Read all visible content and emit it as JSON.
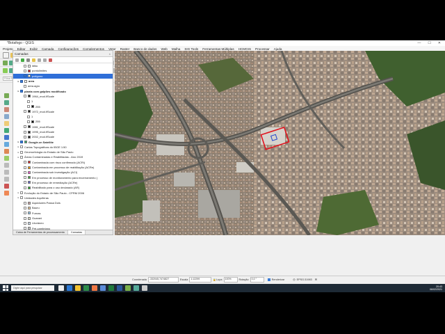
{
  "window": {
    "title": "*Botafogo - QGIS"
  },
  "menu": [
    "Projeto",
    "Editar",
    "Exibir",
    "Camada",
    "Configurações",
    "Complementos",
    "Vetor",
    "Raster",
    "Banco de dados",
    "Web",
    "Malha",
    "SIG Tools",
    "Ferramentas Múltiplas",
    "HCMGIS",
    "Processar",
    "Ajuda"
  ],
  "toolbar": {
    "search_placeholder": "Filtrar Base de Atual...",
    "scale_field": "12",
    "units_field": "mm"
  },
  "layers_panel": {
    "title": "Camadas",
    "close_icon": "×",
    "tabs": [
      "Caixa de Ferramentas de processamento",
      "Camadas"
    ],
    "active_tab": 1,
    "rows": [
      {
        "label": "ldiku",
        "indent": 2,
        "checked": false,
        "swatch": "#ffffff",
        "selected": false,
        "bold": false
      },
      {
        "label": "pontolimites",
        "indent": 2,
        "checked": false,
        "swatch": "#d11",
        "selected": false,
        "bold": false
      },
      {
        "label": "polígono",
        "indent": 2,
        "checked": true,
        "swatch": "#fff",
        "selected": true,
        "bold": false
      },
      {
        "label": "area",
        "indent": 1,
        "checked": true,
        "swatch": "#fff",
        "selected": false,
        "bold": true
      },
      {
        "label": "area.agro",
        "indent": 2,
        "checked": false,
        "swatch": "",
        "selected": false,
        "bold": false
      },
      {
        "label": "planta com galpões modificado",
        "indent": 1,
        "checked": true,
        "swatch": "",
        "selected": false,
        "bold": true
      },
      {
        "label": "1964_mod.ifScale",
        "indent": 2,
        "checked": false,
        "swatch": "#222",
        "selected": false,
        "bold": false
      },
      {
        "label": "1",
        "indent": 3,
        "checked": false,
        "swatch": "",
        "selected": false,
        "bold": false
      },
      {
        "label": "255",
        "indent": 3,
        "checked": false,
        "swatch": "#000",
        "selected": false,
        "bold": false
      },
      {
        "label": "1972_mod.ifScale",
        "indent": 2,
        "checked": false,
        "swatch": "#222",
        "selected": false,
        "bold": false
      },
      {
        "label": "1",
        "indent": 3,
        "checked": false,
        "swatch": "",
        "selected": false,
        "bold": false
      },
      {
        "label": "255",
        "indent": 3,
        "checked": false,
        "swatch": "#000",
        "selected": false,
        "bold": false
      },
      {
        "label": "1981_mod.ifScale",
        "indent": 2,
        "checked": false,
        "swatch": "#222",
        "selected": false,
        "bold": false
      },
      {
        "label": "1995_mod.ifScale",
        "indent": 2,
        "checked": false,
        "swatch": "#222",
        "selected": false,
        "bold": false
      },
      {
        "label": "2002_mod.ifScale",
        "indent": 2,
        "checked": false,
        "swatch": "#222",
        "selected": false,
        "bold": false
      },
      {
        "label": "Google.cn Satellite",
        "indent": 1,
        "checked": true,
        "swatch": "#3a6",
        "selected": false,
        "bold": true
      },
      {
        "label": "Cartas Topográficas do IBGE 1:50",
        "indent": 1,
        "checked": false,
        "swatch": "",
        "selected": false,
        "bold": false
      },
      {
        "label": "Geomorfologia do Estado de São Paulo",
        "indent": 1,
        "checked": false,
        "swatch": "",
        "selected": false,
        "bold": false
      },
      {
        "label": "Áreas Contaminadas e Reabilitadas - Ano 2019",
        "indent": 1,
        "checked": false,
        "swatch": "",
        "selected": false,
        "bold": false
      },
      {
        "label": "Contaminada com risco confirmado (ACRi)",
        "indent": 2,
        "checked": false,
        "swatch": "#d22",
        "selected": false,
        "bold": false
      },
      {
        "label": "Contaminada em processo de reabilitação (ACRe)",
        "indent": 2,
        "checked": false,
        "swatch": "#e90",
        "selected": false,
        "bold": false
      },
      {
        "label": "Contaminada sob investigação (ACI)",
        "indent": 2,
        "checked": false,
        "swatch": "#e5c",
        "selected": false,
        "bold": false
      },
      {
        "label": "Em processo de monitoramento para encerramento (",
        "indent": 2,
        "checked": false,
        "swatch": "#4a4",
        "selected": false,
        "bold": false
      },
      {
        "label": "Em processo de remediação (ACRe)",
        "indent": 2,
        "checked": false,
        "swatch": "#66c",
        "selected": false,
        "bold": false
      },
      {
        "label": "Reabilitado para o uso declarado (AR)",
        "indent": 2,
        "checked": false,
        "swatch": "#2a2",
        "selected": false,
        "bold": false
      },
      {
        "label": "Evolução do Estado de São Paulo - CPRM 2006",
        "indent": 1,
        "checked": false,
        "swatch": "",
        "selected": false,
        "bold": false
      },
      {
        "label": "Unidades Aquíferas",
        "indent": 1,
        "checked": false,
        "swatch": "",
        "selected": false,
        "bold": false
      },
      {
        "label": "Aquicludes Passa Dois",
        "indent": 2,
        "checked": false,
        "swatch": "#caa",
        "selected": false,
        "bold": false
      },
      {
        "label": "Bauru",
        "indent": 2,
        "checked": false,
        "swatch": "#ec9",
        "selected": false,
        "bold": false
      },
      {
        "label": "Furnas",
        "indent": 2,
        "checked": false,
        "swatch": "#9ce",
        "selected": false,
        "bold": false
      },
      {
        "label": "Guarani",
        "indent": 2,
        "checked": false,
        "swatch": "#ddc",
        "selected": false,
        "bold": false
      },
      {
        "label": "Litorâneo",
        "indent": 2,
        "checked": false,
        "swatch": "#cde",
        "selected": false,
        "bold": false
      },
      {
        "label": "Pré-cambriano",
        "indent": 2,
        "checked": false,
        "swatch": "#ccc",
        "selected": false,
        "bold": false
      }
    ]
  },
  "statusbar": {
    "coord_label": "Coordenada",
    "coord_value": "-332045,7474827",
    "scale_label": "Escala",
    "scale_value": "1:12299",
    "magnifier_label": "Lupa",
    "magnifier_value": "100%",
    "rotation_label": "Rotação",
    "rotation_value": "0,0 °",
    "render_label": "Renderizar",
    "crs": "EPSG:31983"
  },
  "taskbar": {
    "search_placeholder": "Digite aqui para pesquisar",
    "time": "20:43",
    "date": "06/02/2021"
  },
  "colors": {
    "selection": "#2f6fd8",
    "taskbar": "#1e2a36",
    "polygon_outline": "#e0141e"
  }
}
